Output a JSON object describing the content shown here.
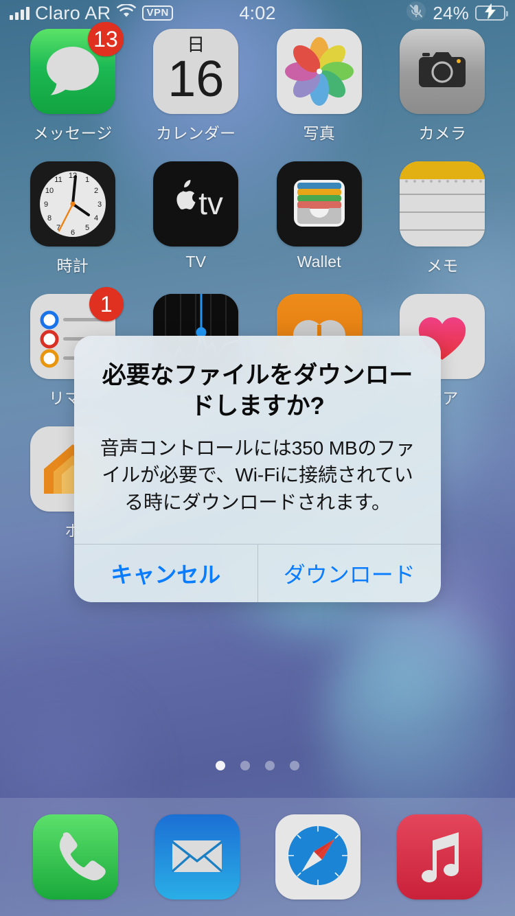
{
  "status_bar": {
    "carrier": "Claro AR",
    "signal_icon": "cellular-bars-icon",
    "wifi_icon": "wifi-icon",
    "vpn_label": "VPN",
    "time": "4:02",
    "mic_muted_icon": "microphone-off-icon",
    "battery_percent": "24%",
    "battery_level": 24,
    "battery_charging": true,
    "battery_color": "#4cd964"
  },
  "home_screen": {
    "apps": [
      {
        "name": "messages",
        "label": "メッセージ",
        "badge": "13"
      },
      {
        "name": "calendar",
        "label": "カレンダー",
        "cal_dow": "日",
        "cal_day": "16"
      },
      {
        "name": "photos",
        "label": "写真"
      },
      {
        "name": "camera",
        "label": "カメラ"
      },
      {
        "name": "clock",
        "label": "時計"
      },
      {
        "name": "tv",
        "label": "TV"
      },
      {
        "name": "wallet",
        "label": "Wallet"
      },
      {
        "name": "notes",
        "label": "メモ"
      },
      {
        "name": "reminders",
        "label": "リマイ",
        "badge": "1"
      },
      {
        "name": "stocks",
        "label": ""
      },
      {
        "name": "books",
        "label": ""
      },
      {
        "name": "health",
        "label": "ケア"
      },
      {
        "name": "home",
        "label": "ホ"
      }
    ],
    "page_dots": {
      "total": 4,
      "active": 1
    }
  },
  "dock": {
    "items": [
      {
        "name": "phone",
        "icon": "phone-icon"
      },
      {
        "name": "mail",
        "icon": "envelope-icon"
      },
      {
        "name": "safari",
        "icon": "compass-icon"
      },
      {
        "name": "music",
        "icon": "music-note-icon"
      }
    ]
  },
  "alert": {
    "title": "必要なファイルをダウンロードしますか?",
    "message": "音声コントロールには350 MBのファイルが必要で、Wi-Fiに接続されている時にダウンロードされます。",
    "cancel_label": "キャンセル",
    "confirm_label": "ダウンロード",
    "tint_color": "#0a7cff"
  }
}
